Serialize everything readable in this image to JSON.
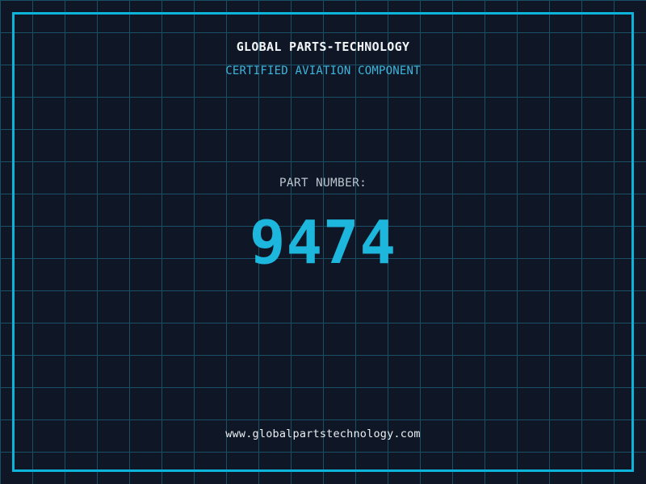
{
  "label_plate": {
    "company_name": "GLOBAL PARTS-TECHNOLOGY",
    "subtitle": "CERTIFIED AVIATION COMPONENT",
    "part_label": "PART NUMBER:",
    "part_number": "9474",
    "website": "www.globalpartstechnology.com"
  },
  "colors": {
    "background": "#0f1726",
    "grid-line": "#1b4f66",
    "frame": "#0cb3da",
    "title-text": "#f2f5f7",
    "subtitle-text": "#3db5dc",
    "label-text": "#b9c4cd",
    "number-text": "#1db6dc",
    "url-text": "#e9eef1"
  }
}
